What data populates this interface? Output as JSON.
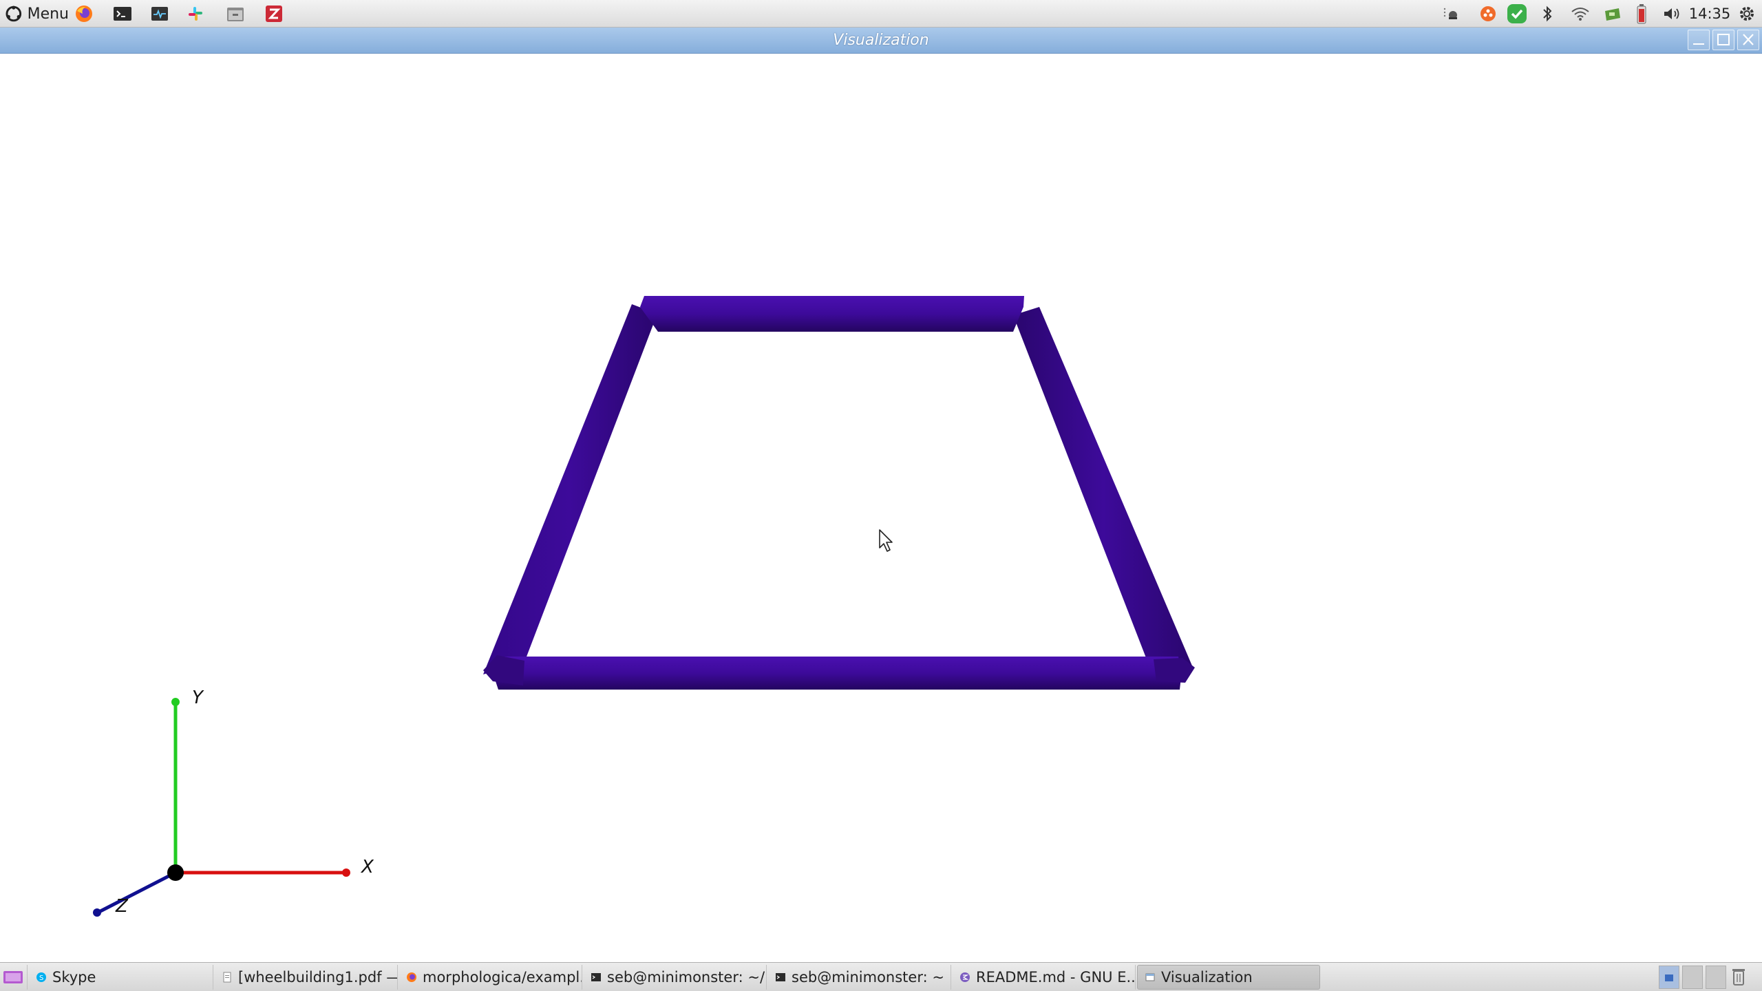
{
  "top_panel": {
    "menu_label": "Menu",
    "launchers": [
      "firefox-icon",
      "terminal-icon",
      "system-monitor-icon",
      "slack-icon",
      "file-manager-icon",
      "zotero-icon"
    ],
    "clock": "14:35"
  },
  "window": {
    "title": "Visualization"
  },
  "scene": {
    "shape_color": "#3d0a9a",
    "axes": {
      "x_label": "X",
      "y_label": "Y",
      "z_label": "Z",
      "x_color": "#d81010",
      "y_color": "#22cc22",
      "z_color": "#101090"
    }
  },
  "taskbar": {
    "tasks": [
      {
        "label": "Skype",
        "icon": "skype-icon"
      },
      {
        "label": "[wheelbuilding1.pdf —...",
        "icon": "document-icon"
      },
      {
        "label": "morphologica/exampl...",
        "icon": "firefox-icon"
      },
      {
        "label": "seb@minimonster: ~/...",
        "icon": "terminal-icon"
      },
      {
        "label": "seb@minimonster: ~",
        "icon": "terminal-icon"
      },
      {
        "label": "README.md - GNU E...",
        "icon": "emacs-icon"
      },
      {
        "label": "Visualization",
        "icon": "window-icon"
      }
    ]
  }
}
